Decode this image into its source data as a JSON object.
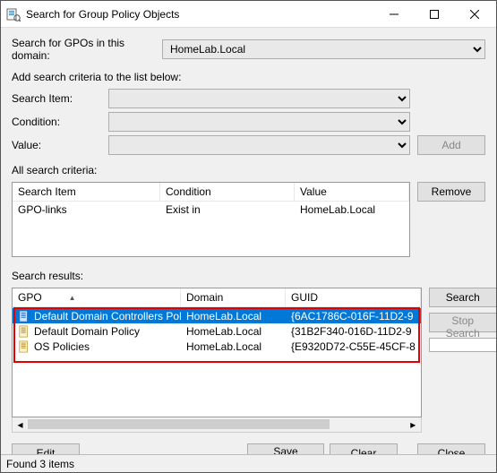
{
  "window": {
    "title": "Search for Group Policy Objects"
  },
  "domainRow": {
    "label": "Search for GPOs in this domain:",
    "value": "HomeLab.Local"
  },
  "addCriteria": {
    "heading": "Add search criteria to the list below:",
    "searchItemLabel": "Search Item:",
    "conditionLabel": "Condition:",
    "valueLabel": "Value:",
    "addBtn": "Add"
  },
  "criteria": {
    "heading": "All search criteria:",
    "cols": {
      "c1": "Search Item",
      "c2": "Condition",
      "c3": "Value"
    },
    "rows": [
      {
        "c1": "GPO-links",
        "c2": "Exist in",
        "c3": "HomeLab.Local"
      }
    ],
    "removeBtn": "Remove"
  },
  "results": {
    "heading": "Search results:",
    "cols": {
      "c1": "GPO",
      "c2": "Domain",
      "c3": "GUID"
    },
    "rows": [
      {
        "name": "Default Domain Controllers Policy",
        "domain": "HomeLab.Local",
        "guid": "{6AC1786C-016F-11D2-9",
        "selected": true
      },
      {
        "name": "Default Domain Policy",
        "domain": "HomeLab.Local",
        "guid": "{31B2F340-016D-11D2-9",
        "selected": false
      },
      {
        "name": "OS Policies",
        "domain": "HomeLab.Local",
        "guid": "{E9320D72-C55E-45CF-8",
        "selected": false
      }
    ],
    "searchBtn": "Search",
    "stopBtn": "Stop Search"
  },
  "bottom": {
    "editBtn": "Edit",
    "saveBtn": "Save results...",
    "clearBtn": "Clear",
    "closeBtn": "Close"
  },
  "status": "Found 3 items"
}
